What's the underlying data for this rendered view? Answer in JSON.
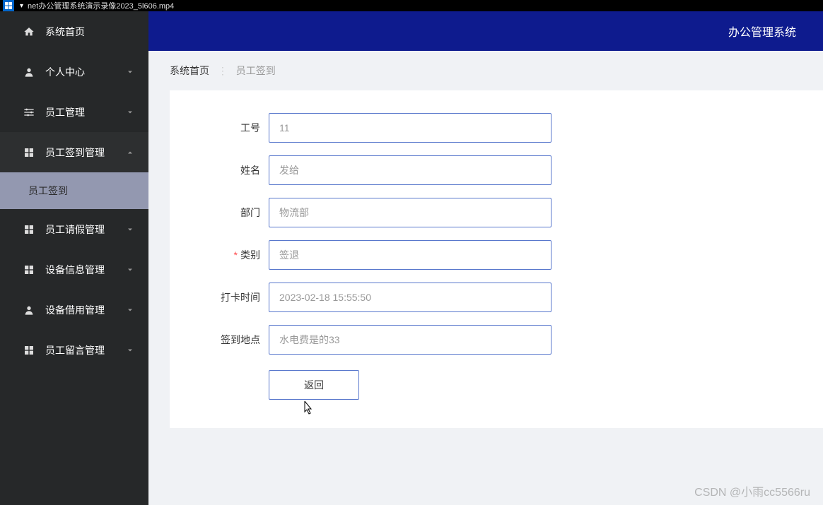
{
  "titlebar": {
    "filename": "net办公管理系统演示录像2023_5l606.mp4"
  },
  "sidebar": {
    "items": [
      {
        "label": "系统首页",
        "icon": "home",
        "arrow": false
      },
      {
        "label": "个人中心",
        "icon": "person",
        "arrow": "down"
      },
      {
        "label": "员工管理",
        "icon": "sliders",
        "arrow": "down"
      },
      {
        "label": "员工签到管理",
        "icon": "grid",
        "arrow": "up",
        "expanded": true,
        "children": [
          {
            "label": "员工签到",
            "active": true
          }
        ]
      },
      {
        "label": "员工请假管理",
        "icon": "grid",
        "arrow": "down"
      },
      {
        "label": "设备信息管理",
        "icon": "grid",
        "arrow": "down"
      },
      {
        "label": "设备借用管理",
        "icon": "person",
        "arrow": "down"
      },
      {
        "label": "员工留言管理",
        "icon": "grid",
        "arrow": "down"
      }
    ]
  },
  "header": {
    "title": "办公管理系统"
  },
  "breadcrumb": {
    "root": "系统首页",
    "current": "员工签到"
  },
  "form": {
    "fields": [
      {
        "label": "工号",
        "value": "11",
        "required": false
      },
      {
        "label": "姓名",
        "value": "发给",
        "required": false
      },
      {
        "label": "部门",
        "value": "物流部",
        "required": false
      },
      {
        "label": "类别",
        "value": "签退",
        "required": true
      },
      {
        "label": "打卡时间",
        "value": "2023-02-18 15:55:50",
        "required": false
      },
      {
        "label": "签到地点",
        "value": "水电费是的33",
        "required": false
      }
    ],
    "button_label": "返回"
  },
  "watermark": "CSDN @小雨cc5566ru"
}
